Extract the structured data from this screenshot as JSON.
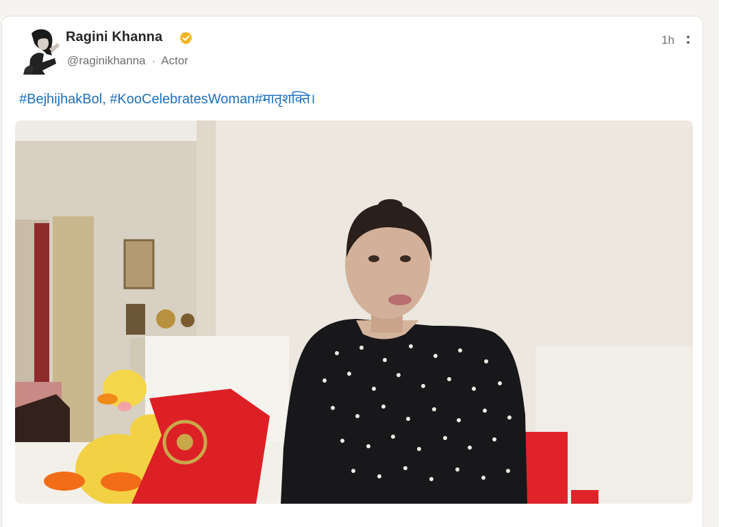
{
  "post": {
    "author": {
      "name": "Ragini Khanna",
      "handle": "@raginikhanna",
      "title": "Actor",
      "verified": true
    },
    "timestamp": "1h",
    "text_segments": [
      "#BejhijhakBol,",
      "#KooCelebratesWoman#मातृशक्ति।"
    ],
    "media": {
      "type": "video",
      "thumbnail": "woman-in-black-sequined-top-seated-on-sofa"
    }
  },
  "icons": {
    "verified": "verified-check-badge-icon",
    "more": "more-vertical-icon"
  },
  "colors": {
    "hashtag": "#1e6fbd",
    "verified_badge": "#f2b51e",
    "name": "#262626",
    "meta": "#6e6e6e",
    "background": "#f5f4f1"
  }
}
